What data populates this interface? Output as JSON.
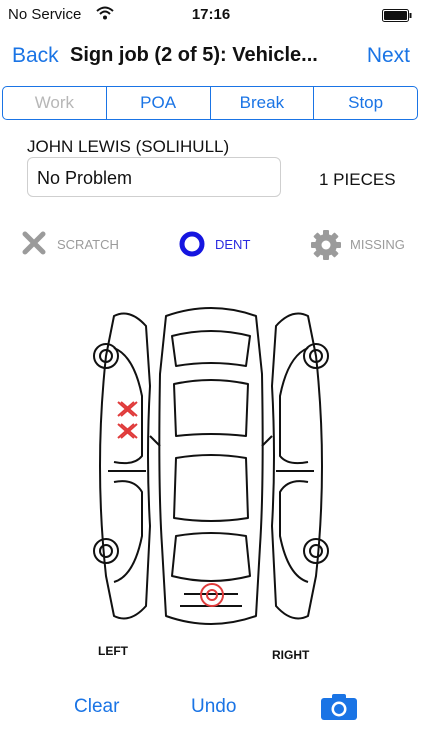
{
  "status_bar": {
    "carrier": "No Service",
    "time": "17:16"
  },
  "nav": {
    "back_label": "Back",
    "title": "Sign job (2 of 5): Vehicle...",
    "next_label": "Next"
  },
  "tabs": [
    {
      "label": "Work",
      "enabled": false
    },
    {
      "label": "POA",
      "enabled": true
    },
    {
      "label": "Break",
      "enabled": true
    },
    {
      "label": "Stop",
      "enabled": true
    }
  ],
  "customer_name": "JOHN LEWIS (SOLIHULL)",
  "status_value": "No Problem",
  "pieces": "1 PIECES",
  "markers": {
    "scratch": {
      "label": "SCRATCH",
      "icon": "x-icon",
      "color": "#9b9b9b"
    },
    "dent": {
      "label": "DENT",
      "icon": "circle-icon",
      "color": "#1515e0",
      "selected": true
    },
    "missing": {
      "label": "MISSING",
      "icon": "gear-icon",
      "color": "#9b9b9b"
    }
  },
  "diagram": {
    "left_label": "LEFT",
    "right_label": "RIGHT",
    "damage_marks": [
      {
        "type": "scratch",
        "color": "#e03b3b"
      },
      {
        "type": "scratch",
        "color": "#e03b3b"
      },
      {
        "type": "dent",
        "color": "#e03b3b"
      }
    ]
  },
  "toolbar": {
    "clear_label": "Clear",
    "undo_label": "Undo",
    "camera_icon": "camera-icon"
  },
  "colors": {
    "accent": "#1a74e5"
  }
}
